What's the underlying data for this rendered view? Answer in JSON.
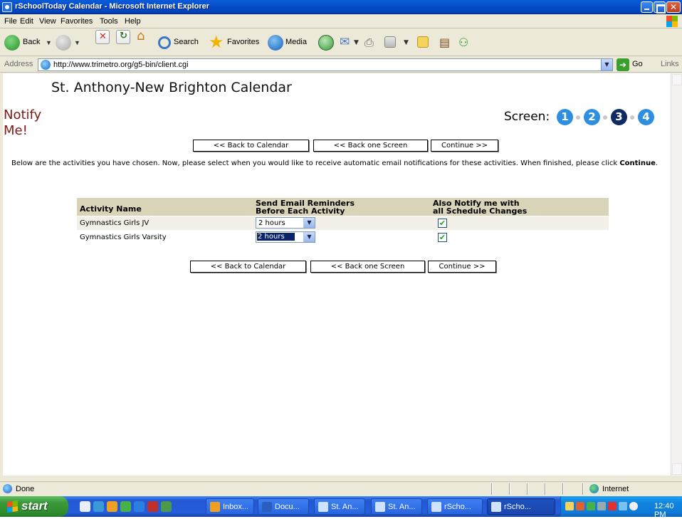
{
  "window": {
    "title": "rSchoolToday Calendar - Microsoft Internet Explorer"
  },
  "menu": [
    "File",
    "Edit",
    "View",
    "Favorites",
    "Tools",
    "Help"
  ],
  "toolbar": {
    "back": "Back",
    "search": "Search",
    "favorites": "Favorites",
    "media": "Media"
  },
  "address": {
    "label": "Address",
    "url": "http://www.trimetro.org/g5-bin/client.cgi",
    "go": "Go",
    "links": "Links"
  },
  "page": {
    "heading": "St. Anthony-New Brighton Calendar",
    "notify_title": "Notify Me!",
    "screen_label": "Screen:",
    "steps": [
      "1",
      "2",
      "3",
      "4"
    ],
    "active_step": "3",
    "buttons": {
      "back_calendar": "<< Back to Calendar",
      "back_screen": "<< Back one Screen",
      "continue": "Continue >>"
    },
    "intro_text": "Below are the activities you have chosen. Now, please select when you would like to receive automatic email notifications for these activities. When finished, please click",
    "intro_bold": "Continue",
    "intro_end": "."
  },
  "table": {
    "col_activity": "Activity Name",
    "col_reminder_1": "Send Email Reminders",
    "col_reminder_2": "Before Each Activity",
    "col_notify_1": "Also Notify me with",
    "col_notify_2": "all Schedule Changes",
    "rows": [
      {
        "name": "Gymnastics Girls JV",
        "reminder": "2 hours",
        "notify": true
      },
      {
        "name": "Gymnastics Girls Varsity",
        "reminder": "2 hours",
        "notify": true
      }
    ]
  },
  "status": {
    "text": "Done",
    "zone": "Internet"
  },
  "taskbar": {
    "start": "start",
    "tasks": [
      "Inbox...",
      "Docu...",
      "St. An...",
      "St. An...",
      "rScho...",
      "rScho..."
    ],
    "clock": "12:40 PM"
  },
  "colors": {
    "notify_title": "#7a1a14",
    "table_header": "#d9d3b8",
    "step_active": "#0d2a63",
    "step_inactive": "#2e8fe0"
  }
}
